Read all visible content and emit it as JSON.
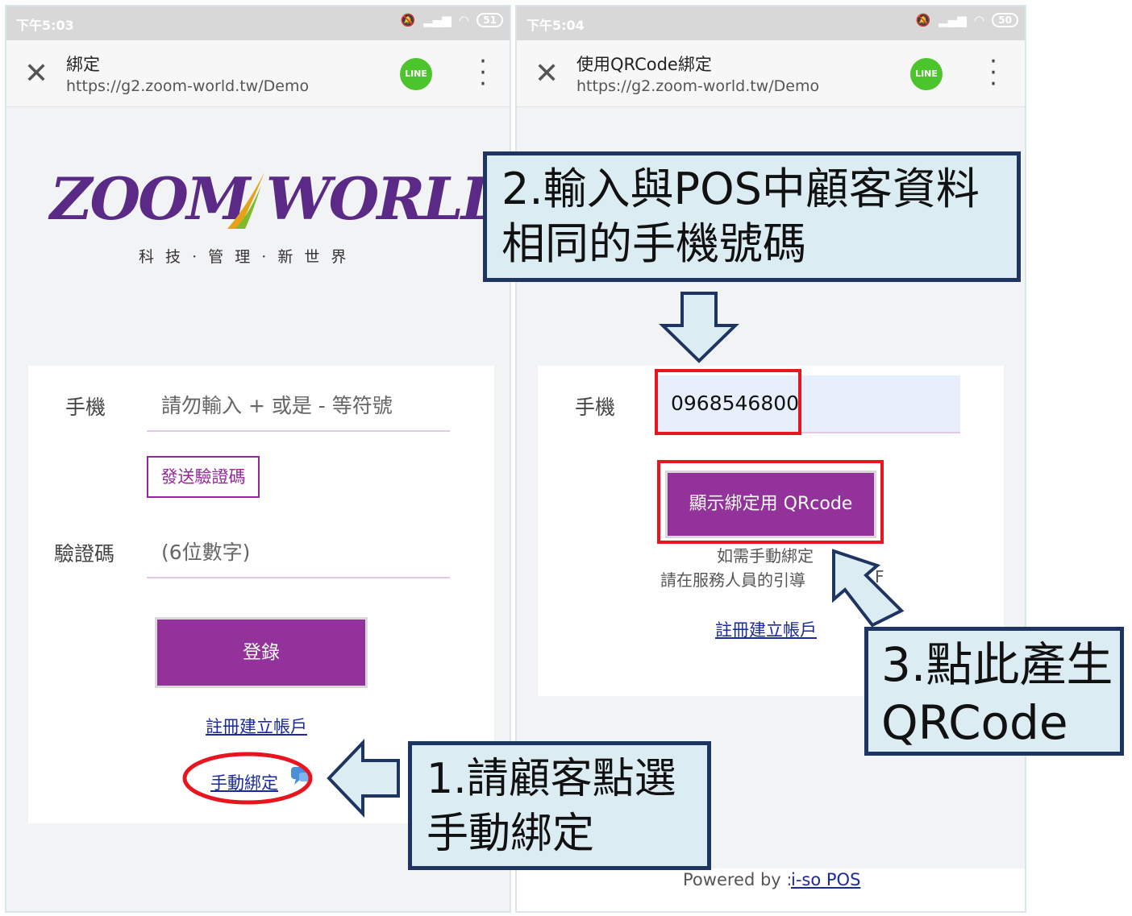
{
  "left": {
    "status": {
      "time": "下午5:03",
      "battery": "51"
    },
    "titlebar": {
      "title": "綁定",
      "url": "https://g2.zoom-world.tw/Demo",
      "line_label": "LINE"
    },
    "logo": {
      "text": "ZOOM WORLD",
      "tagline": "科 技 · 管 理 · 新 世 界"
    },
    "form": {
      "phone_label": "手機",
      "phone_placeholder": "請勿輸入 + 或是 - 等符號",
      "send_code_button": "發送驗證碼",
      "code_label": "驗證碼",
      "code_placeholder": "(6位數字)",
      "login_button": "登錄",
      "register_link": "註冊建立帳戶",
      "manual_bind_link": "手動綁定"
    }
  },
  "right": {
    "status": {
      "time": "下午5:04",
      "battery": "50"
    },
    "titlebar": {
      "title": "使用QRCode綁定",
      "url": "https://g2.zoom-world.tw/Demo",
      "line_label": "LINE"
    },
    "form": {
      "phone_label": "手機",
      "phone_value": "0968546800",
      "qr_button": "顯示綁定用 QRcode",
      "hint_line1": "如需手動綁定",
      "hint_line2": "請在服務人員的引導",
      "hint_suffix": "F",
      "register_link": "註冊建立帳戶"
    },
    "footer": {
      "powered_by": "Powered by : ",
      "powered_link": "i-so POS"
    }
  },
  "callouts": {
    "step1": {
      "line1": "1.請顧客點選",
      "line2": "手動綁定"
    },
    "step2": {
      "line1": "2.輸入與POS中顧客資料",
      "line2": "相同的手機號碼"
    },
    "step3": {
      "line1": "3.點此產生",
      "line2": "QRCode"
    }
  },
  "colors": {
    "purple": "#94329b",
    "callout_bg": "#dcecf3",
    "callout_border": "#1d3560",
    "highlight_red": "#e8141e",
    "link_blue": "#1a2a9c"
  }
}
